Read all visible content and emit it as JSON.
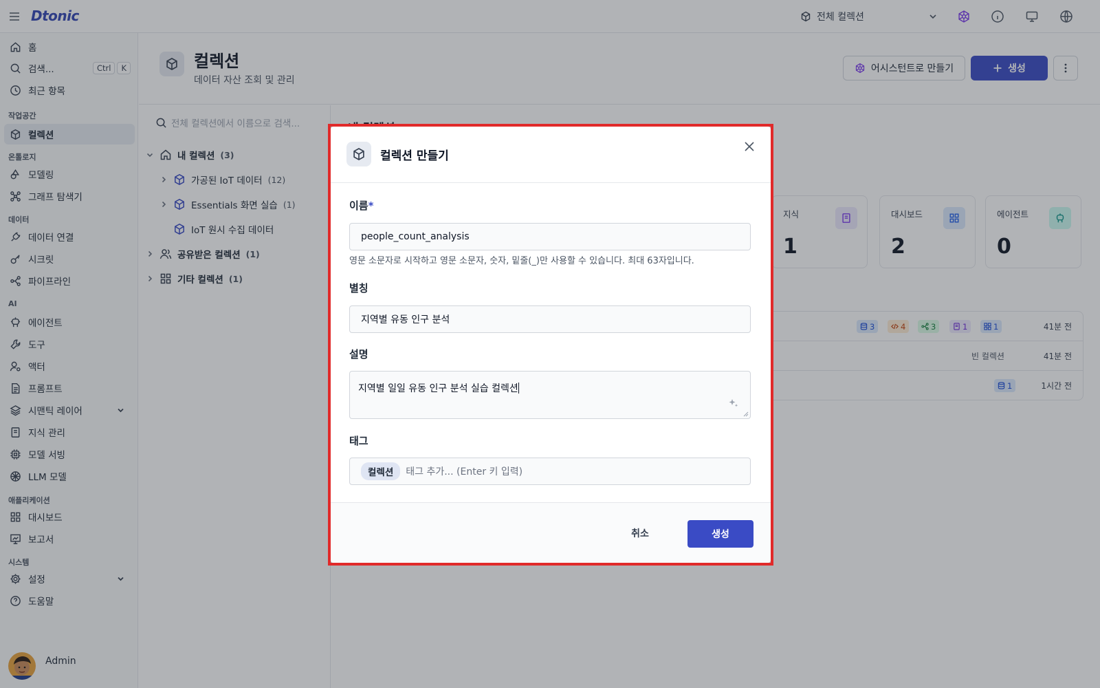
{
  "app": {
    "logo": "Dtonic"
  },
  "topbar": {
    "collection_select": "전체 컬렉션",
    "icons": [
      "menu-icon",
      "cube-icon",
      "chevron-down-icon",
      "assistant-icon",
      "info-icon",
      "monitor-icon",
      "globe-icon"
    ]
  },
  "sidebar": {
    "home": "홈",
    "search": "검색...",
    "search_keys": [
      "Ctrl",
      "K"
    ],
    "recent": "최근 항목",
    "sec_workspace": "작업공간",
    "collections": "컬렉션",
    "sec_ontology": "온톨로지",
    "modeling": "모델링",
    "graph_explore": "그래프 탐색기",
    "sec_data": "데이터",
    "data_connect": "데이터 연결",
    "secrets": "시크릿",
    "pipeline": "파이프라인",
    "sec_ai": "AI",
    "agents": "에이전트",
    "tools": "도구",
    "actors": "액터",
    "prompts": "프롬프트",
    "semantic_layer": "시맨틱 레이어",
    "knowledge": "지식 관리",
    "model_serving": "모델 서빙",
    "llm_models": "LLM 모델",
    "sec_apps": "애플리케이션",
    "dashboards": "대시보드",
    "reports": "보고서",
    "sec_system": "시스템",
    "settings": "설정",
    "help": "도움말",
    "user_name": "Admin"
  },
  "header": {
    "title": "컬렉션",
    "subtitle": "데이터 자산 조회 및 관리",
    "assistant_btn": "어시스턴트로 만들기",
    "create_btn": "생성"
  },
  "tree": {
    "search_placeholder": "전체 컬렉션에서 이름으로 검색...",
    "my_collections": "내 컬렉션",
    "my_count": "(3)",
    "items": [
      {
        "label": "가공된 IoT 데이터",
        "count": "(12)"
      },
      {
        "label": "Essentials 화면 실습",
        "count": "(1)"
      },
      {
        "label": "IoT 원시 수집 데이터",
        "count": ""
      }
    ],
    "shared": "공유받은 컬렉션",
    "shared_count": "(1)",
    "other": "기타 컬렉션",
    "other_count": "(1)"
  },
  "main": {
    "section_title": "내 컬렉션",
    "stats": [
      {
        "label": "지식",
        "value": "1",
        "icon": "book-icon",
        "color": "#7c3aed",
        "bg": "#ede9fe"
      },
      {
        "label": "대시보드",
        "value": "2",
        "icon": "dashboard-icon",
        "color": "#2563eb",
        "bg": "#dbeafe"
      },
      {
        "label": "에이전트",
        "value": "0",
        "icon": "agent-icon",
        "color": "#0d9488",
        "bg": "#ccfbf1"
      }
    ],
    "rows": [
      {
        "badges": [
          "3",
          "4",
          "3",
          "1",
          "1"
        ],
        "time": "41분 전"
      },
      {
        "empty": "빈 컬렉션",
        "time": "41분 전"
      },
      {
        "badges": [
          "1"
        ],
        "time": "1시간 전"
      }
    ]
  },
  "modal": {
    "title": "컬렉션 만들기",
    "name_label": "이름",
    "required_mark": "*",
    "name_value": "people_count_analysis",
    "name_hint": "영문 소문자로 시작하고 영문 소문자, 숫자, 밑줄(_)만 사용할 수 있습니다. 최대 63자입니다.",
    "alias_label": "별칭",
    "alias_value": "지역별 유동 인구 분석",
    "desc_label": "설명",
    "desc_value": "지역별 일일 유동 인구 분석 실습 컬렉션",
    "tags_label": "태그",
    "tag_chip": "컬렉션",
    "tag_placeholder": "태그 추가... (Enter 키 입력)",
    "cancel": "취소",
    "submit": "생성"
  },
  "colors": {
    "accent": "#3a4bc5",
    "highlight_border": "#e12a2a"
  }
}
